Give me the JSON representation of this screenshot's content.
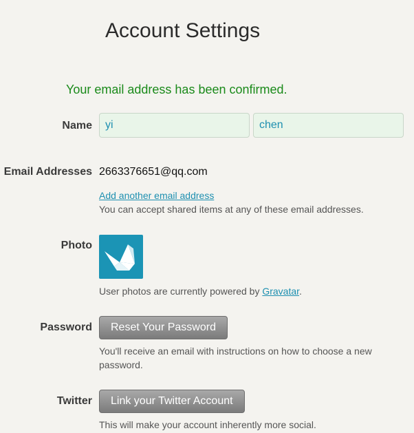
{
  "page": {
    "title": "Account Settings",
    "confirmation_message": "Your email address has been confirmed."
  },
  "name": {
    "label": "Name",
    "first_name_value": "yi",
    "last_name_value": "chen"
  },
  "email": {
    "label": "Email Addresses",
    "address": "2663376651@qq.com",
    "add_link": "Add another email address",
    "help": "You can accept shared items at any of these email addresses."
  },
  "photo": {
    "label": "Photo",
    "icon": "crane-icon",
    "help_prefix": "User photos are currently powered by ",
    "help_link": "Gravatar",
    "help_suffix": "."
  },
  "password": {
    "label": "Password",
    "button": "Reset Your Password",
    "help_line1": "You'll receive an email with instructions on how to choose a new",
    "help_line2": "password."
  },
  "twitter": {
    "label": "Twitter",
    "button": "Link your Twitter Account",
    "help": "This will make your account inherently more social."
  },
  "colors": {
    "background": "#f4f3ef",
    "success": "#1a8a1a",
    "link": "#1d8fb0",
    "photo_bg": "#1b94b5",
    "input_bg": "#e9f5e9"
  }
}
